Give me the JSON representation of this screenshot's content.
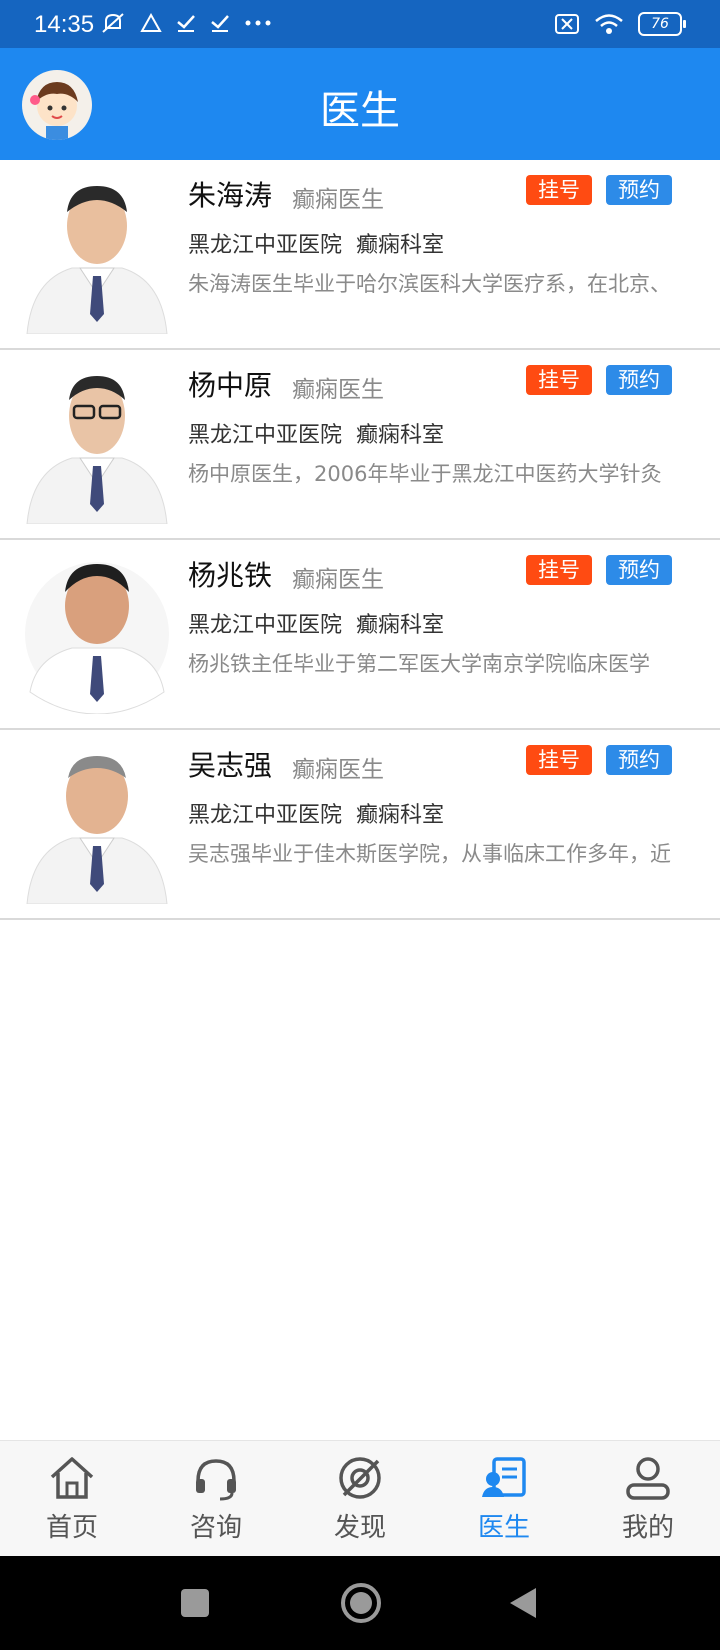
{
  "status_bar": {
    "time": "14:35",
    "battery": "76"
  },
  "app_bar": {
    "title": "医生"
  },
  "buttons": {
    "register": "挂号",
    "book": "预约"
  },
  "doctors": [
    {
      "name": "朱海涛",
      "title": "癫痫医生",
      "hospital": "黑龙江中亚医院",
      "department": "癫痫科室",
      "desc": "朱海涛医生毕业于哈尔滨医科大学医疗系，在北京、"
    },
    {
      "name": "杨中原",
      "title": "癫痫医生",
      "hospital": "黑龙江中亚医院",
      "department": "癫痫科室",
      "desc": "杨中原医生，2006年毕业于黑龙江中医药大学针灸"
    },
    {
      "name": "杨兆铁",
      "title": "癫痫医生",
      "hospital": "黑龙江中亚医院",
      "department": "癫痫科室",
      "desc": "杨兆铁主任毕业于第二军医大学南京学院临床医学"
    },
    {
      "name": "吴志强",
      "title": "癫痫医生",
      "hospital": "黑龙江中亚医院",
      "department": "癫痫科室",
      "desc": "吴志强毕业于佳木斯医学院，从事临床工作多年，近"
    }
  ],
  "tabs": [
    {
      "label": "首页",
      "icon": "home-icon"
    },
    {
      "label": "咨询",
      "icon": "headset-icon"
    },
    {
      "label": "发现",
      "icon": "discover-icon"
    },
    {
      "label": "医生",
      "icon": "doctor-icon",
      "active": true
    },
    {
      "label": "我的",
      "icon": "user-icon"
    }
  ],
  "colors": {
    "primary": "#1e88f0",
    "status_bar": "#1565c0",
    "register": "#ff4b12",
    "book": "#2d8be8"
  }
}
